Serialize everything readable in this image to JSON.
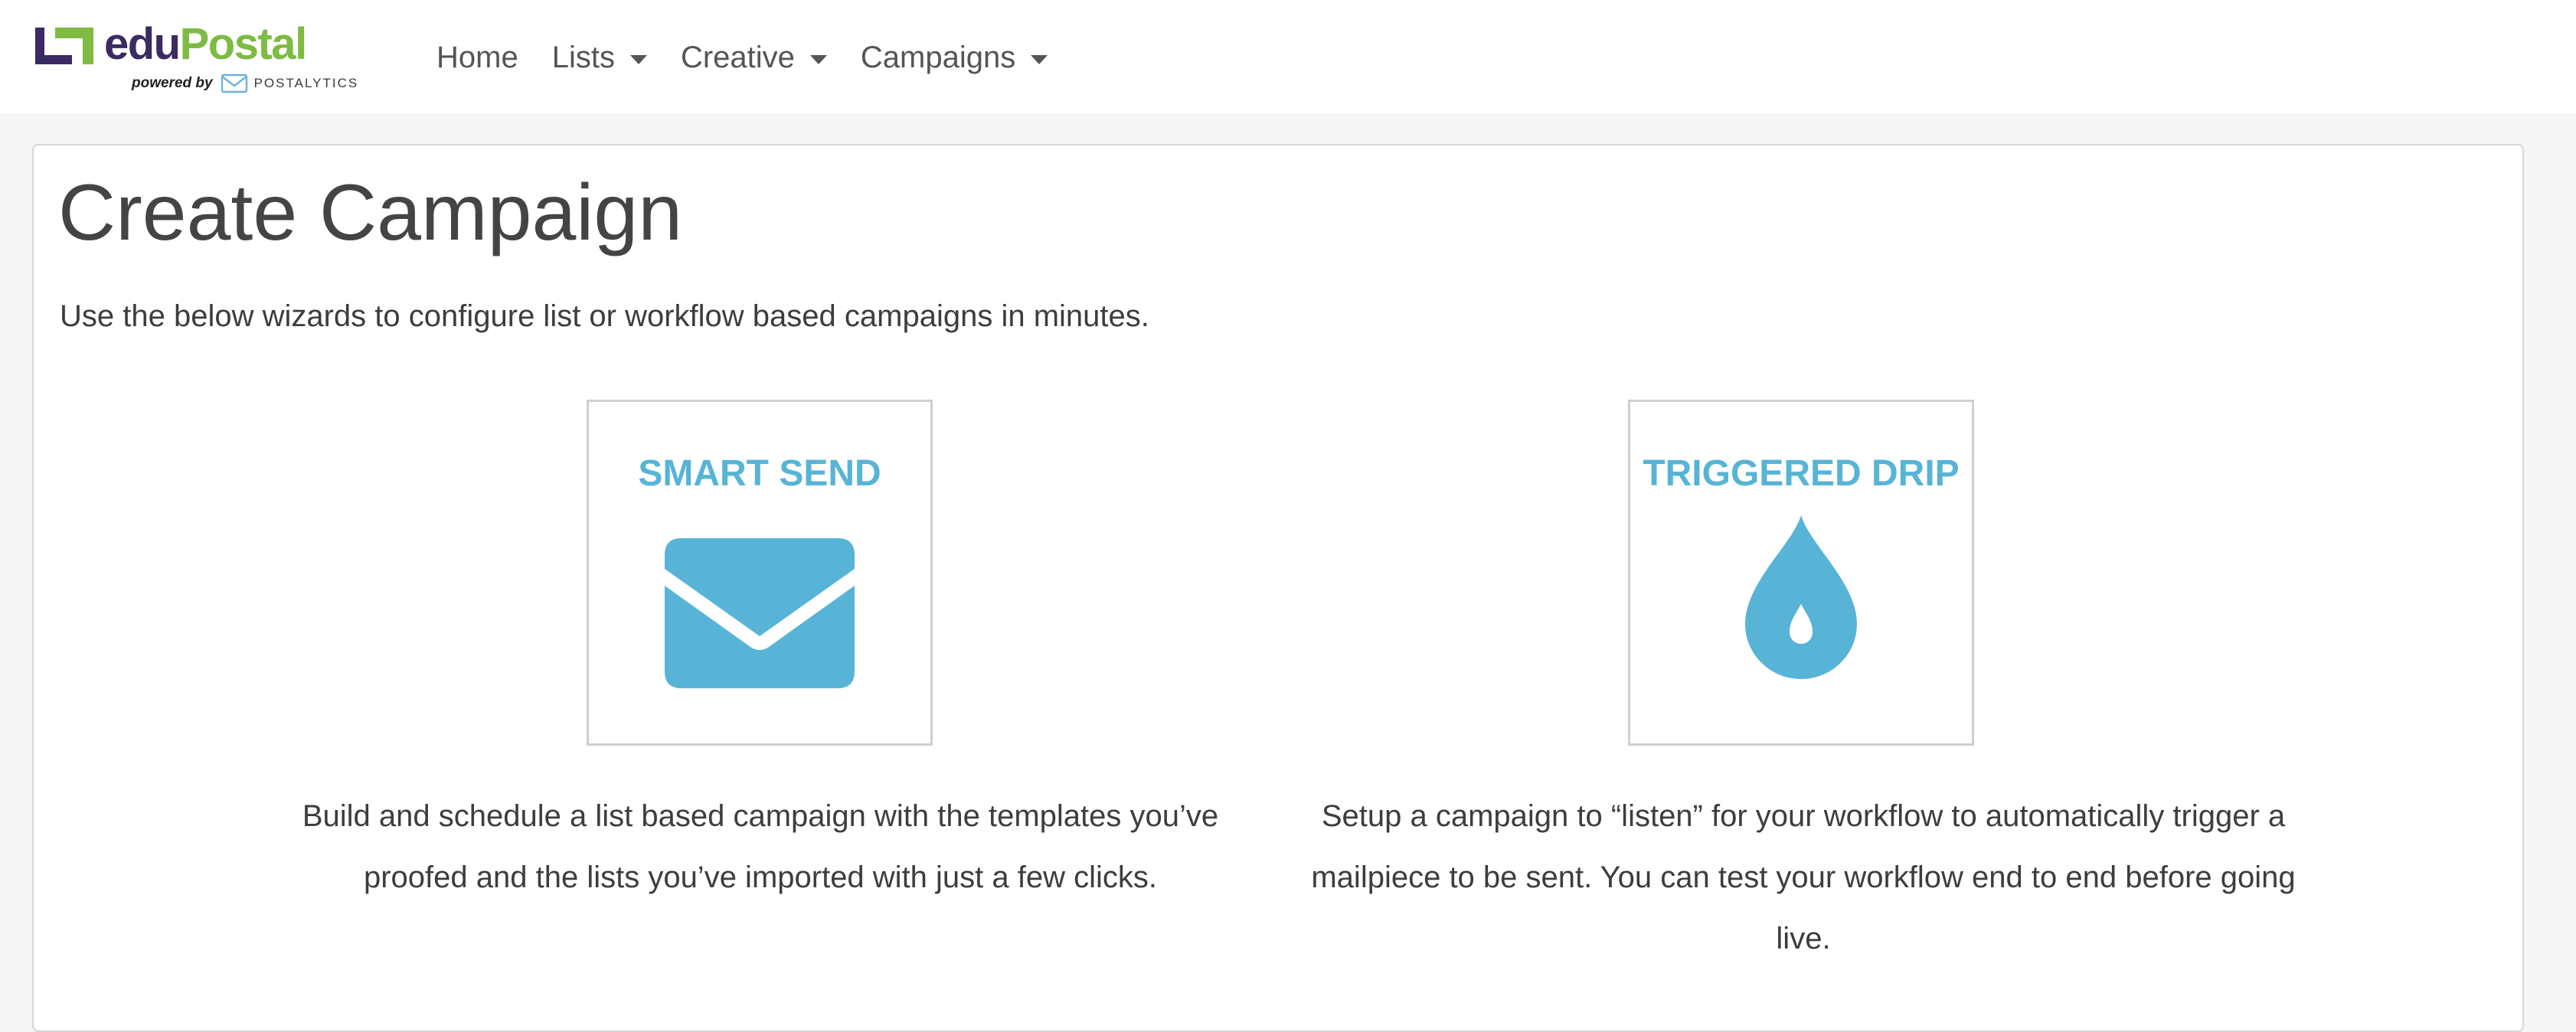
{
  "brand": {
    "name_part1": "edu",
    "name_part2": "Postal",
    "powered_by": "powered by",
    "partner": "POSTALYTICS",
    "colors": {
      "purple": "#3b2a63",
      "green": "#7dbb42"
    }
  },
  "nav": {
    "items": [
      {
        "label": "Home",
        "dropdown": false
      },
      {
        "label": "Lists",
        "dropdown": true
      },
      {
        "label": "Creative",
        "dropdown": true
      },
      {
        "label": "Campaigns",
        "dropdown": true
      }
    ]
  },
  "main": {
    "title": "Create Campaign",
    "intro": "Use the below wizards to configure list or workflow based campaigns in minutes.",
    "cards": [
      {
        "title": "SMART SEND",
        "icon": "envelope-icon",
        "description": "Build and schedule a list based campaign with the templates you’ve proofed and the lists you’ve imported with just a few clicks."
      },
      {
        "title": "TRIGGERED DRIP",
        "icon": "drop-icon",
        "description": "Setup a campaign to “listen” for your workflow to automatically trigger a mailpiece to be sent. You can test your workflow end to end before going live."
      }
    ],
    "accent_color": "#57b4d6"
  }
}
